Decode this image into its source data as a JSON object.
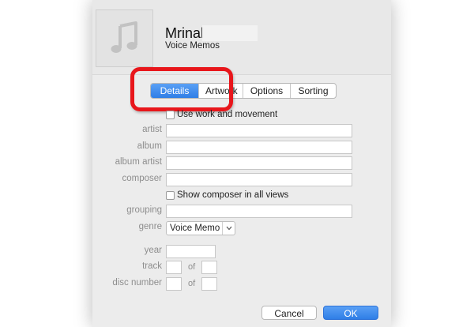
{
  "header": {
    "title": "Mrinal",
    "subtitle": "Voice Memos",
    "artwork_icon": "music-note-icon"
  },
  "tabs": [
    {
      "label": "Details",
      "active": true
    },
    {
      "label": "Artwork",
      "active": false
    },
    {
      "label": "Options",
      "active": false
    },
    {
      "label": "Sorting",
      "active": false
    }
  ],
  "checkboxes": {
    "work_movement": {
      "label": "Use work and movement",
      "checked": false
    },
    "show_composer": {
      "label": "Show composer in all views",
      "checked": false
    }
  },
  "fields": {
    "artist": {
      "label": "artist",
      "value": ""
    },
    "album": {
      "label": "album",
      "value": ""
    },
    "album_artist": {
      "label": "album artist",
      "value": ""
    },
    "composer": {
      "label": "composer",
      "value": ""
    },
    "grouping": {
      "label": "grouping",
      "value": ""
    },
    "genre": {
      "label": "genre",
      "value": "Voice Memo"
    },
    "year": {
      "label": "year",
      "value": ""
    },
    "track": {
      "label": "track",
      "value": "",
      "of_label": "of",
      "of_value": ""
    },
    "disc_number": {
      "label": "disc number",
      "value": "",
      "of_label": "of",
      "of_value": ""
    }
  },
  "buttons": {
    "cancel": "Cancel",
    "ok": "OK"
  },
  "colors": {
    "accent": "#2f7ee6",
    "highlight_ring": "#e8161b"
  }
}
